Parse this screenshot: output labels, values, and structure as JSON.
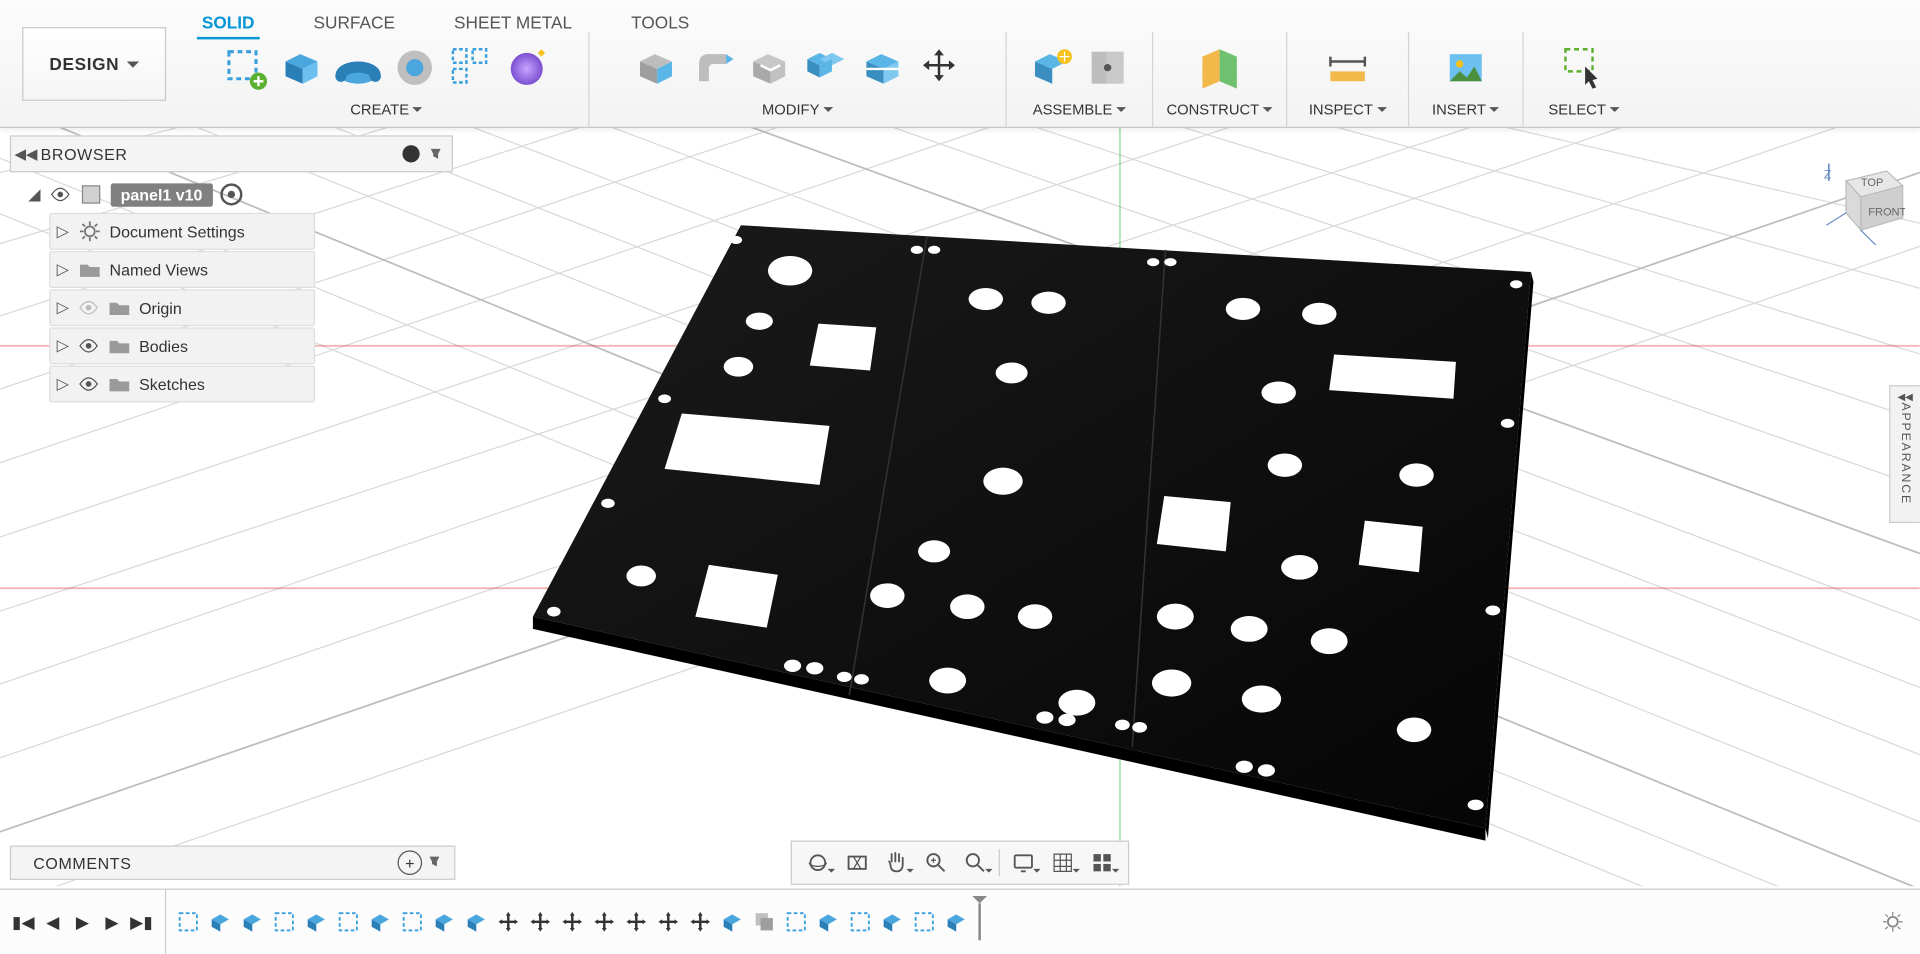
{
  "workspace_label": "DESIGN",
  "ribbon_tabs": [
    "SOLID",
    "SURFACE",
    "SHEET METAL",
    "TOOLS"
  ],
  "active_tab": 0,
  "ribbon_groups": {
    "create": "CREATE",
    "modify": "MODIFY",
    "assemble": "ASSEMBLE",
    "construct": "CONSTRUCT",
    "inspect": "INSPECT",
    "insert": "INSERT",
    "select": "SELECT"
  },
  "browser_title": "BROWSER",
  "browser_root": "panel1 v10",
  "browser_items": {
    "doc_settings": "Document Settings",
    "named_views": "Named Views",
    "origin": "Origin",
    "bodies": "Bodies",
    "sketches": "Sketches"
  },
  "comments_title": "COMMENTS",
  "viewcube": {
    "top": "TOP",
    "front": "FRONT"
  },
  "appearance_tab": "APPEARANCE"
}
